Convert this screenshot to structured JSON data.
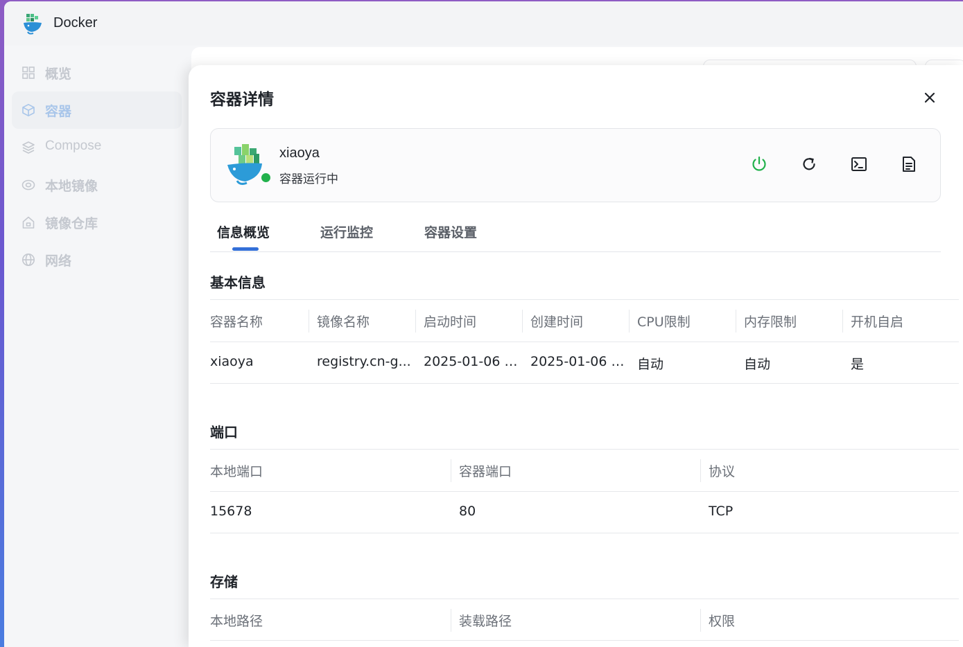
{
  "app": {
    "title": "Docker",
    "logo": "docker-whale-logo"
  },
  "sidebar": {
    "items": [
      {
        "label": "概览",
        "icon": "grid-icon"
      },
      {
        "label": "容器",
        "icon": "cube-icon",
        "active": true
      },
      {
        "label": "Compose",
        "icon": "layers-icon"
      },
      {
        "label": "本地镜像",
        "icon": "disk-icon"
      },
      {
        "label": "镜像仓库",
        "icon": "home-icon"
      },
      {
        "label": "网络",
        "icon": "globe-icon"
      }
    ]
  },
  "drawer": {
    "title": "容器详情",
    "close_icon": "close-icon",
    "container": {
      "name": "xiaoya",
      "status": "容器运行中",
      "status_color": "#22b14c",
      "actions": [
        "power-icon",
        "restart-icon",
        "terminal-icon",
        "log-file-icon"
      ]
    },
    "tabs": [
      {
        "label": "信息概览",
        "active": true
      },
      {
        "label": "运行监控"
      },
      {
        "label": "容器设置"
      }
    ],
    "accent": "#3470d8",
    "basic": {
      "title": "基本信息",
      "headers": [
        "容器名称",
        "镜像名称",
        "启动时间",
        "创建时间",
        "CPU限制",
        "内存限制",
        "开机自启"
      ],
      "row": [
        "xiaoya",
        "registry.cn-g...",
        "2025-01-06 1...",
        "2025-01-06 1...",
        "自动",
        "自动",
        "是"
      ]
    },
    "ports": {
      "title": "端口",
      "headers": [
        "本地端口",
        "容器端口",
        "协议"
      ],
      "row": [
        "15678",
        "80",
        "TCP"
      ]
    },
    "storage": {
      "title": "存储",
      "headers": [
        "本地路径",
        "装载路径",
        "权限"
      ]
    }
  }
}
